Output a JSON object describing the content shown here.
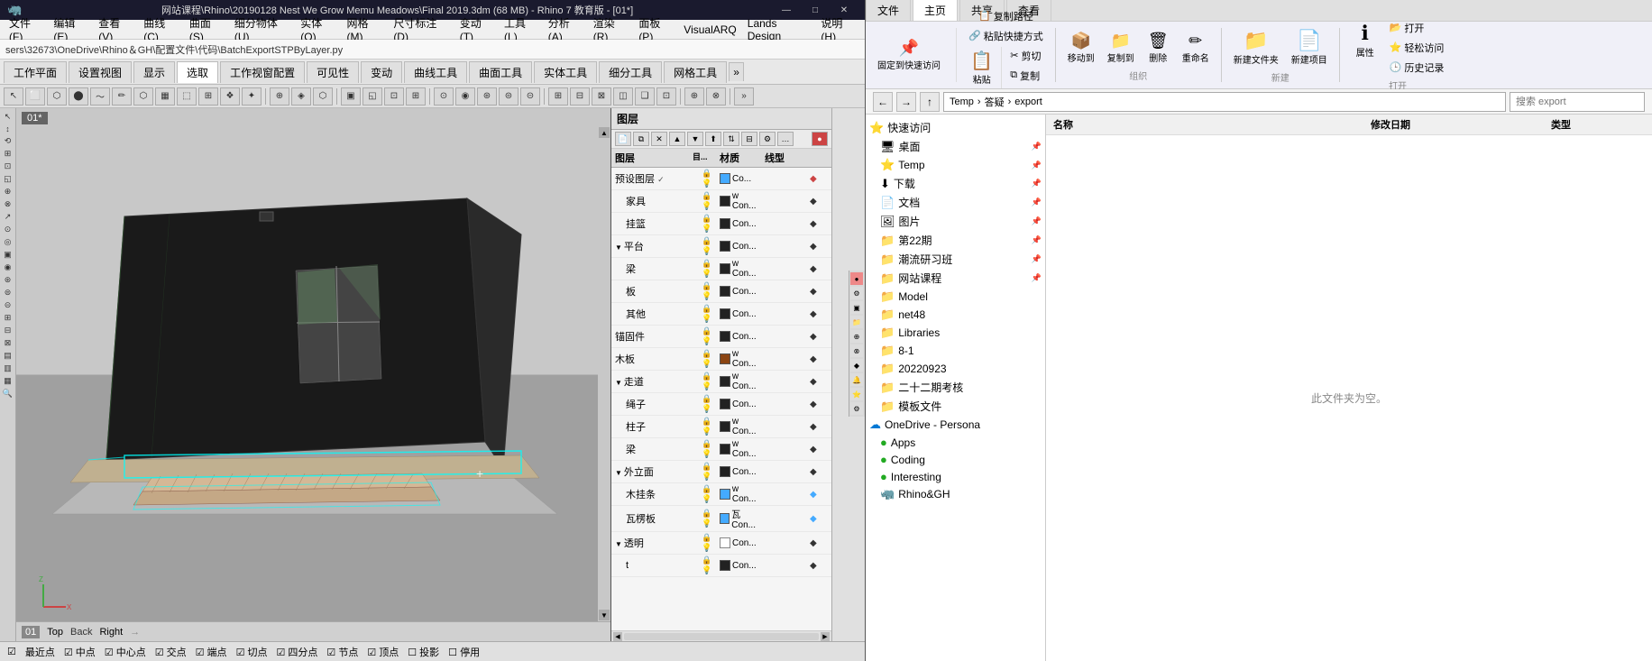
{
  "titlebar": {
    "title": "网站课程\\Rhino\\20190128 Nest We Grow Memu Meadows\\Final 2019.3dm (68 MB) - Rhino 7 教育版 - [01*]",
    "minimize": "—",
    "maximize": "□",
    "close": "✕"
  },
  "menubar": {
    "items": [
      "文件(F)",
      "编辑(E)",
      "查看(V)",
      "曲线(C)",
      "曲面(S)",
      "细分物体(U)",
      "实体(O)",
      "网格(M)",
      "尺寸标注(D)",
      "变动(T)",
      "工具(L)",
      "分析(A)",
      "渲染(R)",
      "面板(P)",
      "VisualARQ",
      "Lands Design",
      "说明(H)"
    ]
  },
  "pathbar": {
    "path": "sers\\32673\\OneDrive\\Rhino＆GH\\配置文件\\代码\\BatchExportSTPByLayer.py"
  },
  "toolbar_tabs": {
    "tabs": [
      "工作平面",
      "设置视图",
      "显示",
      "选取",
      "工作视窗配置",
      "可见性",
      "变动",
      "曲线工具",
      "曲面工具",
      "实体工具",
      "细分工具",
      "网格工具"
    ]
  },
  "viewport": {
    "label": "01*",
    "views": [
      "01",
      "Top",
      "Back",
      "Right"
    ],
    "cursor": "⊕"
  },
  "layers": {
    "title": "图层",
    "columns": [
      "图层",
      "目...",
      "材质",
      "线型",
      ""
    ],
    "rows": [
      {
        "name": "预设图层",
        "indent": 0,
        "checked": true,
        "color": "#44aaff",
        "material": "Co...",
        "expand": false
      },
      {
        "name": "家具",
        "indent": 1,
        "color": "#222222",
        "material": "w Con...",
        "expand": false
      },
      {
        "name": "挂篮",
        "indent": 1,
        "color": "#222222",
        "material": "Con...",
        "expand": false
      },
      {
        "name": "平台",
        "indent": 0,
        "color": "#222222",
        "material": "Con...",
        "expand": true
      },
      {
        "name": "梁",
        "indent": 1,
        "color": "#222222",
        "material": "w Con...",
        "expand": false
      },
      {
        "name": "板",
        "indent": 1,
        "color": "#222222",
        "material": "Con...",
        "expand": false
      },
      {
        "name": "其他",
        "indent": 1,
        "color": "#222222",
        "material": "Con...",
        "expand": false
      },
      {
        "name": "锚固件",
        "indent": 0,
        "color": "#222222",
        "material": "Con...",
        "expand": false
      },
      {
        "name": "木板",
        "indent": 0,
        "color": "#8B4513",
        "material": "w Con...",
        "expand": false
      },
      {
        "name": "走道",
        "indent": 0,
        "color": "#222222",
        "material": "w Con...",
        "expand": true
      },
      {
        "name": "绳子",
        "indent": 1,
        "color": "#222222",
        "material": "Con...",
        "expand": false
      },
      {
        "name": "柱子",
        "indent": 1,
        "color": "#222222",
        "material": "w Con...",
        "expand": false
      },
      {
        "name": "梁",
        "indent": 1,
        "color": "#222222",
        "material": "w Con...",
        "expand": false
      },
      {
        "name": "外立面",
        "indent": 0,
        "color": "#222222",
        "material": "Con...",
        "expand": true
      },
      {
        "name": "木挂条",
        "indent": 1,
        "color": "#44aaff",
        "material": "w Con...",
        "expand": false
      },
      {
        "name": "瓦楞板",
        "indent": 1,
        "color": "#44aaff",
        "material": "瓦 Con...",
        "expand": false
      },
      {
        "name": "透明",
        "indent": 0,
        "color": "#222222",
        "material": "Con...",
        "expand": true
      },
      {
        "name": "t",
        "indent": 1,
        "color": "#222222",
        "material": "Con...",
        "expand": false
      }
    ]
  },
  "explorer": {
    "ribbon_tabs": [
      "文件",
      "主页",
      "共享",
      "查看"
    ],
    "active_tab": "主页",
    "ribbon_groups": {
      "clipboard": {
        "pin": "固定到快速访问",
        "copy": "复制",
        "paste": "粘贴",
        "paste_path": "复制路径",
        "paste_shortcut": "粘贴快捷方式",
        "cut": "剪切"
      },
      "organize": {
        "move": "移动到",
        "copy_to": "复制到",
        "delete": "删除",
        "rename": "重命名"
      },
      "new": {
        "new_folder": "新建文件夹",
        "new_item": "新建项目"
      },
      "open": {
        "open": "打开",
        "easy_access": "轻松访问",
        "properties": "属性",
        "history": "历史记录"
      }
    },
    "address": {
      "back": "←",
      "forward": "→",
      "up": "↑",
      "path_parts": [
        "Temp",
        "答疑",
        "export"
      ],
      "separator": "›"
    },
    "tree": {
      "items": [
        {
          "icon": "⭐",
          "label": "快速访问",
          "expanded": true,
          "pin": false
        },
        {
          "icon": "🖥",
          "label": "桌面",
          "pin": true
        },
        {
          "icon": "⭐",
          "label": "Temp",
          "pin": true
        },
        {
          "icon": "⬇",
          "label": "下载",
          "pin": true
        },
        {
          "icon": "📄",
          "label": "文档",
          "pin": true
        },
        {
          "icon": "🖼",
          "label": "图片",
          "pin": true
        },
        {
          "icon": "📁",
          "label": "第22期",
          "pin": true
        },
        {
          "icon": "📁",
          "label": "潮流研习班",
          "pin": true
        },
        {
          "icon": "📁",
          "label": "网站课程",
          "pin": true
        },
        {
          "icon": "📁",
          "label": "Model",
          "pin": false
        },
        {
          "icon": "📁",
          "label": "net48",
          "pin": false
        },
        {
          "icon": "📁",
          "label": "Libraries",
          "pin": false
        },
        {
          "icon": "📁",
          "label": "8-1",
          "pin": false
        },
        {
          "icon": "📁",
          "label": "20220923",
          "pin": false
        },
        {
          "icon": "📁",
          "label": "二十二期考核",
          "pin": false
        },
        {
          "icon": "📁",
          "label": "模板文件",
          "pin": false
        },
        {
          "icon": "☁",
          "label": "OneDrive - Persona",
          "pin": false
        },
        {
          "icon": "📱",
          "label": "Apps",
          "pin": false,
          "color": "#22aa22"
        },
        {
          "icon": "💻",
          "label": "Coding",
          "pin": false,
          "color": "#22aa22"
        },
        {
          "icon": "✨",
          "label": "Interesting",
          "pin": false,
          "color": "#22aa22"
        },
        {
          "icon": "🦏",
          "label": "Rhino&GH",
          "pin": false
        }
      ]
    },
    "content_columns": [
      "名称",
      "修改日期",
      "类型"
    ],
    "empty_message": "此文件夹为空。",
    "current_folder": "export"
  },
  "statusbar": {
    "items": [
      "最近点",
      "中点",
      "中心点",
      "交点",
      "端点",
      "切点",
      "四分点",
      "节点",
      "顶点",
      "投影",
      "停用"
    ],
    "checked": [
      "最近点",
      "中点",
      "中心点",
      "交点",
      "端点",
      "切点",
      "四分点",
      "节点",
      "顶点"
    ]
  }
}
